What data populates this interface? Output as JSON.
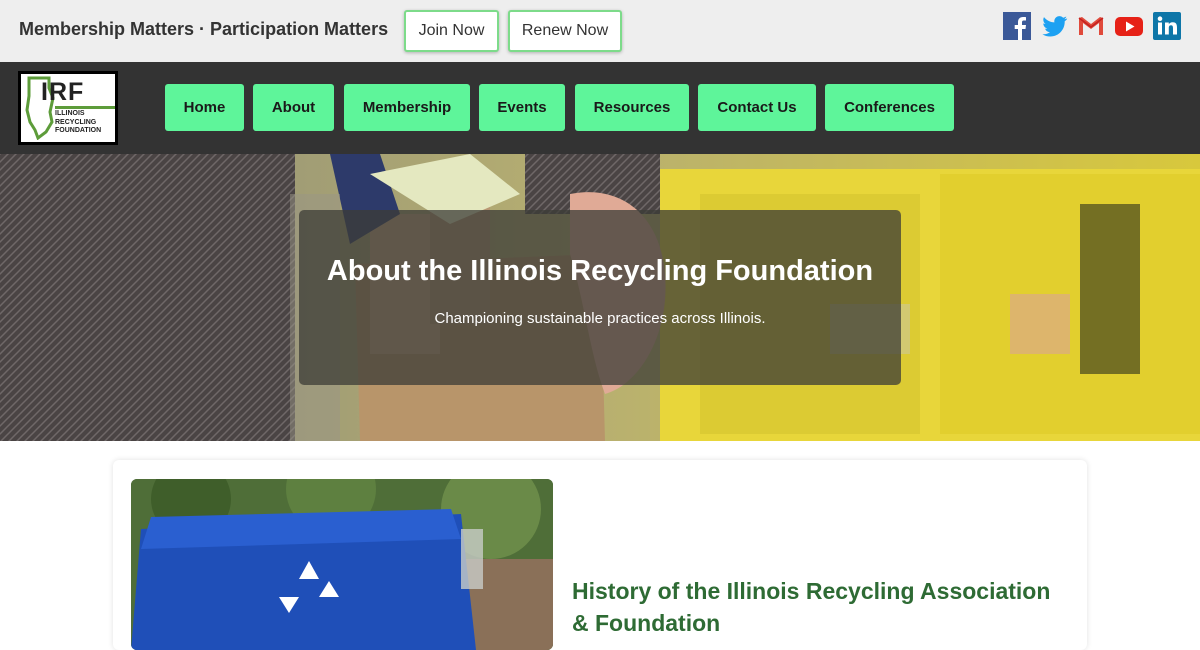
{
  "topbar": {
    "tagline": "Membership Matters · Participation Matters",
    "join_label": "Join Now",
    "renew_label": "Renew Now",
    "social": [
      "facebook-icon",
      "twitter-icon",
      "gmail-icon",
      "youtube-icon",
      "linkedin-icon"
    ]
  },
  "logo": {
    "mark": "IRF",
    "line1": "ILLINOIS",
    "line2": "RECYCLING",
    "line3": "FOUNDATION"
  },
  "nav": {
    "items": [
      {
        "label": "Home"
      },
      {
        "label": "About"
      },
      {
        "label": "Membership"
      },
      {
        "label": "Events"
      },
      {
        "label": "Resources"
      },
      {
        "label": "Contact Us"
      },
      {
        "label": "Conferences"
      }
    ]
  },
  "hero": {
    "title": "About the Illinois Recycling Foundation",
    "subtitle": "Championing sustainable practices across Illinois."
  },
  "section": {
    "title": "History of the Illinois Recycling Association & Foundation"
  },
  "colors": {
    "nav_bg": "#333333",
    "nav_button": "#5ef59a",
    "heading_green": "#2e6b34",
    "facebook": "#3b5998",
    "twitter": "#1da1f2",
    "youtube": "#e62117",
    "linkedin": "#0e76a8"
  }
}
